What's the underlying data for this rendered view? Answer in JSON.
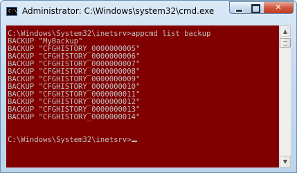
{
  "window": {
    "title": "Administrator: C:\\Windows\\system32\\cmd.exe",
    "icon": "cmd-icon",
    "icon_text": "C:\\"
  },
  "caption_buttons": {
    "minimize": "minimize-icon",
    "maximize": "maximize-icon",
    "close": "✕"
  },
  "console": {
    "background": "#800000",
    "foreground": "#c0c0c0",
    "lines": [
      "C:\\Windows\\System32\\inetsrv>appcmd list backup",
      "BACKUP \"MyBackup\"",
      "BACKUP \"CFGHISTORY_0000000005\"",
      "BACKUP \"CFGHISTORY_0000000006\"",
      "BACKUP \"CFGHISTORY_0000000007\"",
      "BACKUP \"CFGHISTORY_0000000008\"",
      "BACKUP \"CFGHISTORY_0000000009\"",
      "BACKUP \"CFGHISTORY_0000000010\"",
      "BACKUP \"CFGHISTORY_0000000011\"",
      "BACKUP \"CFGHISTORY_0000000012\"",
      "BACKUP \"CFGHISTORY_0000000013\"",
      "BACKUP \"CFGHISTORY_0000000014\"",
      "",
      "C:\\Windows\\System32\\inetsrv>"
    ]
  },
  "scrollbar": {
    "up": "▲",
    "down": "▼"
  }
}
